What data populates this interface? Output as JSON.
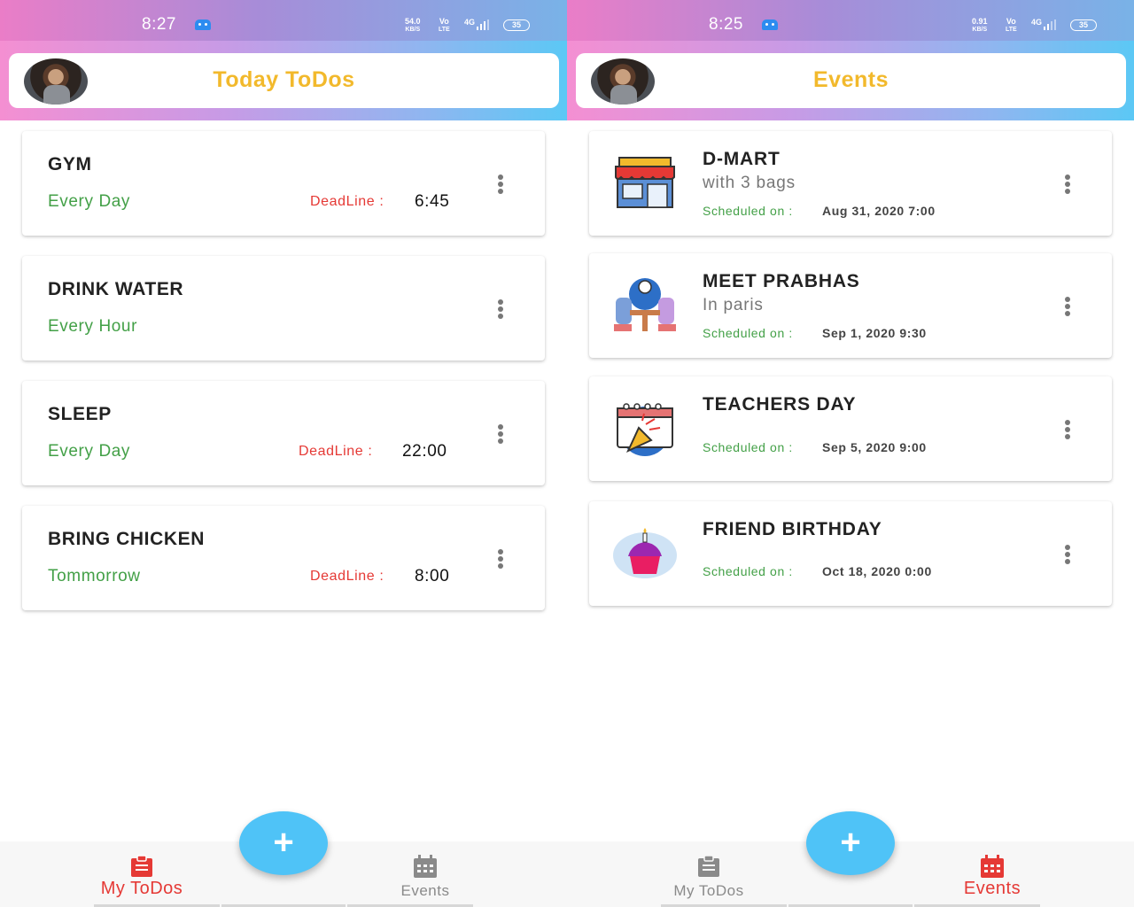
{
  "status_left": {
    "time": "8:27",
    "net_speed_top": "54.0",
    "net_speed_bottom": "KB/S",
    "carrier_top": "Vo",
    "carrier_bottom": "LTE",
    "network": "4G",
    "battery": "35"
  },
  "status_right": {
    "time": "8:25",
    "net_speed_top": "0.91",
    "net_speed_bottom": "KB/S",
    "carrier_top": "Vo",
    "carrier_bottom": "LTE",
    "network": "4G",
    "battery": "35"
  },
  "todos_screen": {
    "title": "Today ToDos",
    "items": [
      {
        "title": "GYM",
        "frequency": "Every Day",
        "deadline_label": "DeadLine :",
        "deadline": "6:45"
      },
      {
        "title": "DRINK WATER",
        "frequency": "Every Hour",
        "deadline_label": "",
        "deadline": ""
      },
      {
        "title": "SLEEP",
        "frequency": "Every Day",
        "deadline_label": "DeadLine :",
        "deadline": "22:00"
      },
      {
        "title": "BRING CHICKEN",
        "frequency": "Tommorrow",
        "deadline_label": "DeadLine :",
        "deadline": "8:00"
      }
    ]
  },
  "events_screen": {
    "title": "Events",
    "items": [
      {
        "title": "D-MART",
        "subtitle": "with 3 bags",
        "scheduled_label": "Scheduled on :",
        "date": "Aug 31, 2020 7:00",
        "icon": "store-icon"
      },
      {
        "title": "MEET PRABHAS",
        "subtitle": "In paris",
        "scheduled_label": "Scheduled on :",
        "date": "Sep 1, 2020 9:30",
        "icon": "meeting-icon"
      },
      {
        "title": "TEACHERS DAY",
        "subtitle": "",
        "scheduled_label": "Scheduled on :",
        "date": "Sep 5, 2020 9:00",
        "icon": "calendar-party-icon"
      },
      {
        "title": "FRIEND BIRTHDAY",
        "subtitle": "",
        "scheduled_label": "Scheduled on :",
        "date": "Oct 18, 2020 0:00",
        "icon": "cupcake-icon"
      }
    ]
  },
  "bottom_nav": {
    "todos_label": "My ToDos",
    "events_label": "Events",
    "fab_label": "+"
  },
  "colors": {
    "accent_title": "#f2b92c",
    "active_nav": "#e53935",
    "inactive_nav": "#8a8a8a",
    "fab": "#4fc3f7",
    "green": "#43a047",
    "deadline": "#e53935"
  }
}
